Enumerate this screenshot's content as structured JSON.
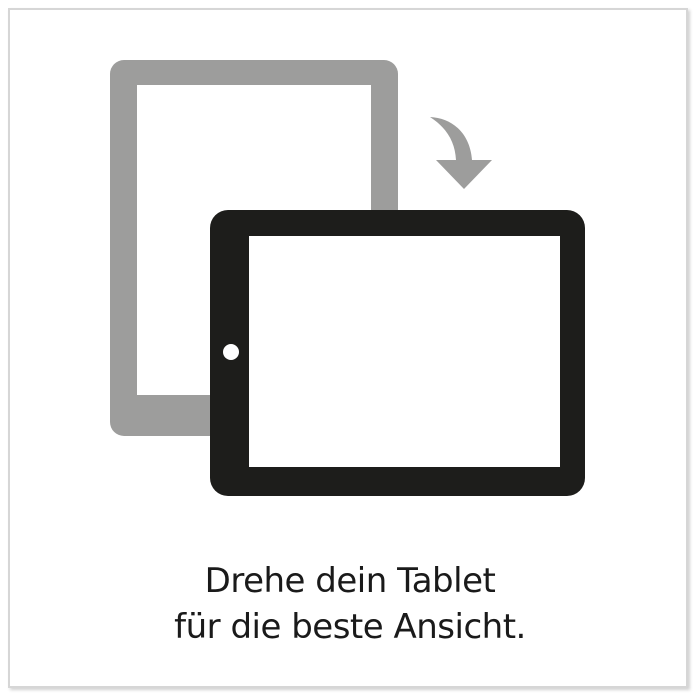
{
  "message": {
    "line1": "Drehe dein Tablet",
    "line2": "für die beste Ansicht."
  },
  "icons": {
    "portrait_tablet": "tablet-portrait-icon",
    "landscape_tablet": "tablet-landscape-icon",
    "rotate_arrow": "rotate-arrow-icon"
  },
  "colors": {
    "portrait_tablet": "#9d9d9c",
    "landscape_tablet": "#1d1d1b",
    "arrow": "#9d9d9c",
    "text": "#1a1a1a",
    "border": "#d6d6d6"
  }
}
